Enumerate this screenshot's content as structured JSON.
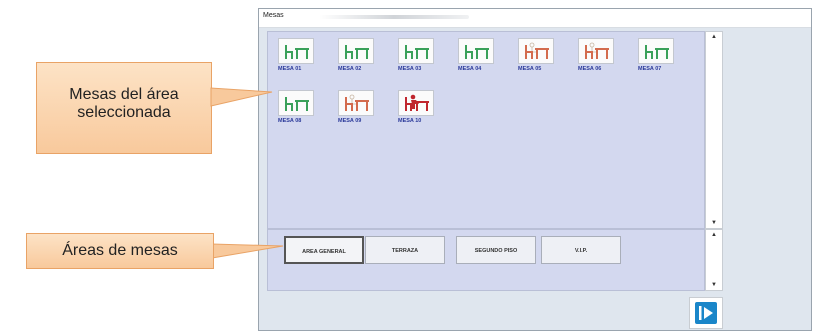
{
  "window": {
    "title": "Mesas"
  },
  "tables": [
    {
      "label": "MESA 01",
      "state": "free"
    },
    {
      "label": "MESA 02",
      "state": "free"
    },
    {
      "label": "MESA 03",
      "state": "free"
    },
    {
      "label": "MESA 04",
      "state": "free"
    },
    {
      "label": "MESA 05",
      "state": "reserved"
    },
    {
      "label": "MESA 06",
      "state": "reserved"
    },
    {
      "label": "MESA 07",
      "state": "free"
    },
    {
      "label": "MESA 08",
      "state": "free"
    },
    {
      "label": "MESA 09",
      "state": "reserved"
    },
    {
      "label": "MESA 10",
      "state": "occupied"
    }
  ],
  "areas": [
    {
      "label": "AREA GENERAL",
      "active": true
    },
    {
      "label": "TERRAZA",
      "active": false
    },
    {
      "label": "SEGUNDO PISO",
      "active": false
    },
    {
      "label": "V.I.P.",
      "active": false
    }
  ],
  "callouts": {
    "tables_line1": "Mesas del área",
    "tables_line2": "seleccionada",
    "areas": "Áreas de mesas"
  },
  "colors": {
    "free": "#3aa05a",
    "reserved": "#d36b4e",
    "occupied": "#c0262e",
    "exit": "#1a86c9"
  },
  "icons": {
    "free": "table-icon",
    "reserved": "reserved-table-icon",
    "occupied": "occupied-table-icon",
    "exit": "exit-icon"
  }
}
